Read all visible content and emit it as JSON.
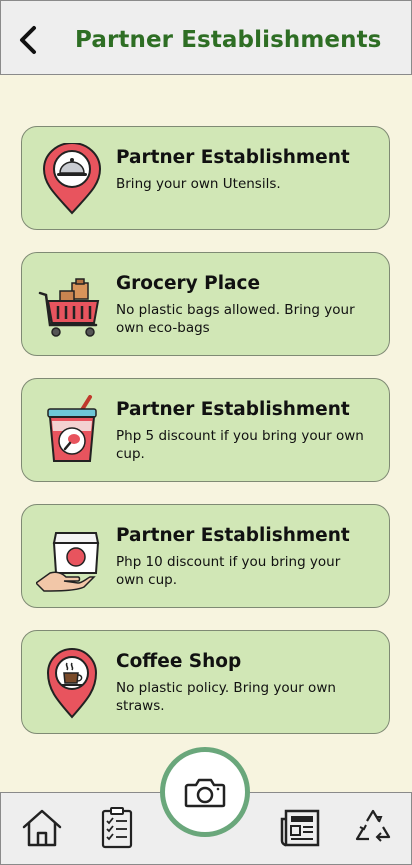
{
  "header": {
    "title": "Partner Establishments"
  },
  "cards": [
    {
      "title": "Partner Establishment",
      "desc": "Bring your own Utensils.",
      "icon": "food-location-pin-icon"
    },
    {
      "title": "Grocery Place",
      "desc": "No plastic bags allowed. Bring your own eco-bags",
      "icon": "shopping-cart-icon"
    },
    {
      "title": "Partner Establishment",
      "desc": "Php 5 discount if you bring your own cup.",
      "icon": "drink-cup-icon"
    },
    {
      "title": "Partner Establishment",
      "desc": "Php 10 discount if you bring your own cup.",
      "icon": "takeout-box-hand-icon"
    },
    {
      "title": "Coffee Shop",
      "desc": "No plastic policy. Bring your own straws.",
      "icon": "coffee-location-pin-icon"
    }
  ],
  "bottom_nav": {
    "items": [
      "home-icon",
      "checklist-icon",
      "news-icon",
      "recycle-icon"
    ],
    "center": "camera-icon"
  },
  "colors": {
    "background": "#f7f4df",
    "card": "#d1e7b6",
    "title_green": "#2e6e24",
    "camera_ring": "#6aa77b",
    "pin_red": "#e8545e"
  }
}
